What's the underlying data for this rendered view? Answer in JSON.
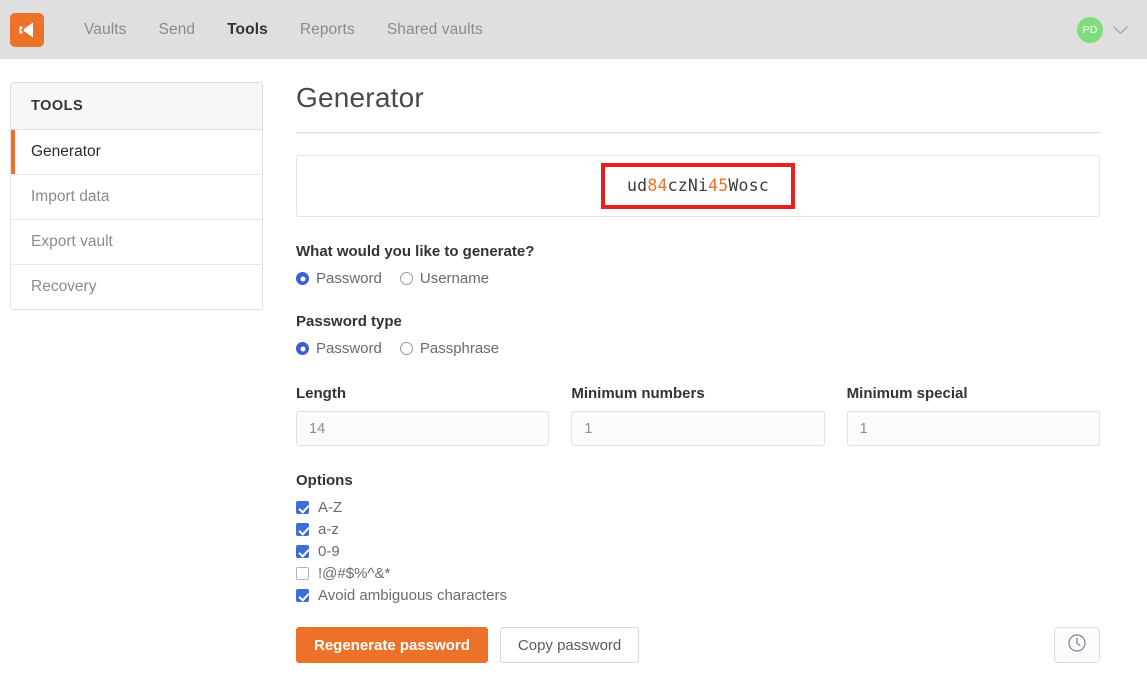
{
  "header": {
    "logo_icon": "bitwarden-shield-icon",
    "nav": [
      {
        "label": "Vaults",
        "active": false
      },
      {
        "label": "Send",
        "active": false
      },
      {
        "label": "Tools",
        "active": true
      },
      {
        "label": "Reports",
        "active": false
      },
      {
        "label": "Shared vaults",
        "active": false
      }
    ],
    "avatar_initials": "PD",
    "avatar_color": "#7ede7e",
    "caret_icon": "chevron-down-icon"
  },
  "sidebar": {
    "heading": "TOOLS",
    "items": [
      {
        "label": "Generator",
        "active": true
      },
      {
        "label": "Import data",
        "active": false
      },
      {
        "label": "Export vault",
        "active": false
      },
      {
        "label": "Recovery",
        "active": false
      }
    ],
    "active_accent": "#ec7229"
  },
  "main": {
    "title": "Generator",
    "password": {
      "value": "ud84czNi45Wosc",
      "segments": [
        {
          "text": "ud",
          "kind": "letter"
        },
        {
          "text": "84",
          "kind": "digit"
        },
        {
          "text": "czNi",
          "kind": "letter"
        },
        {
          "text": "45",
          "kind": "digit"
        },
        {
          "text": "Wosc",
          "kind": "letter"
        }
      ],
      "letter_color": "#3c3c3c",
      "digit_color": "#ec7229",
      "highlight_border_color": "#e81f1f"
    },
    "generate_question": {
      "label": "What would you like to generate?",
      "options": [
        {
          "label": "Password",
          "checked": true
        },
        {
          "label": "Username",
          "checked": false
        }
      ]
    },
    "password_type": {
      "label": "Password type",
      "options": [
        {
          "label": "Password",
          "checked": true
        },
        {
          "label": "Passphrase",
          "checked": false
        }
      ]
    },
    "numeric_fields": [
      {
        "label": "Length",
        "value": "14"
      },
      {
        "label": "Minimum numbers",
        "value": "1"
      },
      {
        "label": "Minimum special",
        "value": "1"
      }
    ],
    "options": {
      "label": "Options",
      "items": [
        {
          "label": "A-Z",
          "checked": true
        },
        {
          "label": "a-z",
          "checked": true
        },
        {
          "label": "0-9",
          "checked": true
        },
        {
          "label": "!@#$%^&*",
          "checked": false
        },
        {
          "label": "Avoid ambiguous characters",
          "checked": true
        }
      ]
    },
    "actions": {
      "regenerate_label": "Regenerate password",
      "regenerate_color": "#ec7229",
      "copy_label": "Copy password",
      "history_icon": "clock-history-icon"
    }
  }
}
